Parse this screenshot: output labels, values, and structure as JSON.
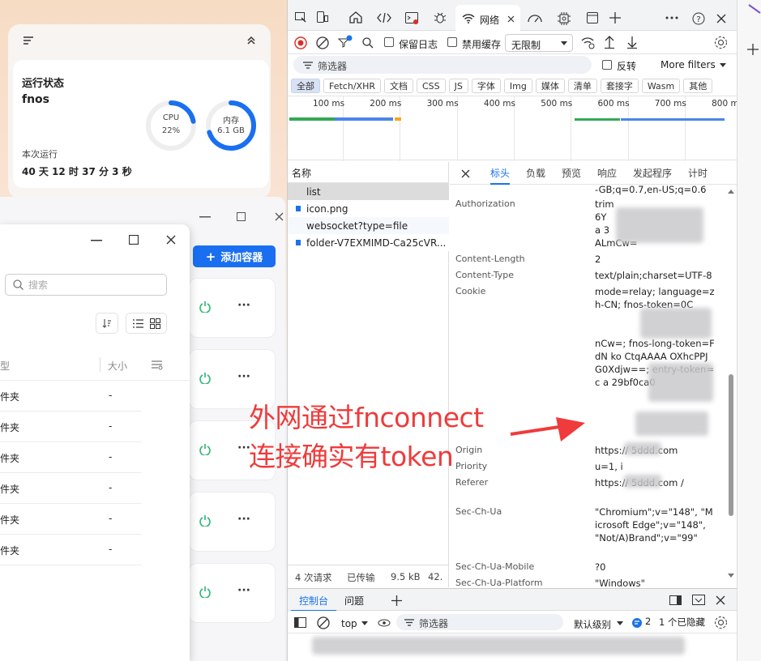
{
  "widget": {
    "title": "运行状态",
    "hostname": "fnos",
    "cpu_label": "CPU",
    "cpu_value": "22%",
    "cpu_fraction": 0.22,
    "mem_label": "内存",
    "mem_value": "6.1 GB",
    "mem_fraction": 0.7,
    "uptime_label": "本次运行",
    "uptime_value": "40 天 12 时 37 分 3 秒",
    "accent": "#1a6ff0"
  },
  "back_window": {
    "add_container_label": "添加容器",
    "container_menu_icon": "···",
    "container_count": 5
  },
  "front_window": {
    "search_placeholder": "搜索",
    "col_type": "型",
    "col_size": "大小",
    "rows": [
      {
        "type": "件夹",
        "size": "-"
      },
      {
        "type": "件夹",
        "size": "-"
      },
      {
        "type": "件夹",
        "size": "-"
      },
      {
        "type": "件夹",
        "size": "-"
      },
      {
        "type": "件夹",
        "size": "-"
      },
      {
        "type": "件夹",
        "size": "-"
      }
    ]
  },
  "devtools": {
    "network_tab": "网络",
    "preserve_log": "保留日志",
    "disable_cache": "禁用缓存",
    "throttle": "无限制",
    "filter_placeholder": "筛选器",
    "invert": "反转",
    "more_filters": "More filters",
    "type_filters": [
      "全部",
      "Fetch/XHR",
      "文档",
      "CSS",
      "JS",
      "字体",
      "Img",
      "媒体",
      "清单",
      "套接字",
      "Wasm",
      "其他"
    ],
    "timeline_ticks": [
      "100 ms",
      "200 ms",
      "300 ms",
      "400 ms",
      "500 ms",
      "600 ms",
      "700 ms",
      "800 ms"
    ],
    "name_header": "名称",
    "requests": [
      "list",
      "icon.png",
      "websocket?type=file",
      "folder-V7EXMIMD-Ca25cVR..."
    ],
    "detail_tabs": [
      "标头",
      "负载",
      "预览",
      "响应",
      "发起程序",
      "计时"
    ],
    "status": {
      "requests": "4 次请求",
      "transferred": "已传输",
      "size": "9.5 kB",
      "more": "42."
    },
    "headers": [
      {
        "key": "",
        "value": "-GB;q=0.7,en-US;q=0.6"
      },
      {
        "key": "Authorization",
        "value": "trim"
      },
      {
        "key": "",
        "value": "6Y"
      },
      {
        "key": "",
        "value": "a                3"
      },
      {
        "key": "",
        "value": "ALmCw="
      },
      {
        "key": "Content-Length",
        "value": "2"
      },
      {
        "key": "Content-Type",
        "value": "text/plain;charset=UTF-8"
      },
      {
        "key": "Cookie",
        "value": "mode=relay; language=zh-CN; fnos-token=0C"
      },
      {
        "key": "",
        "value": "nCw=; fnos-long-token=FdN          ko CtqAAAA OXhcPPJ G0Xdjw==; entry-token=c            a 29bf0ca0"
      },
      {
        "key": "Origin",
        "value": "https://          5ddd.com"
      },
      {
        "key": "Priority",
        "value": "u=1, i"
      },
      {
        "key": "Referer",
        "value": "https://          5ddd.com /"
      },
      {
        "key": "Sec-Ch-Ua",
        "value": "\"Chromium\";v=\"148\", \"Microsoft Edge\";v=\"148\", \"Not/A)Brand\";v=\"99\""
      },
      {
        "key": "Sec-Ch-Ua-Mobile",
        "value": "?0"
      },
      {
        "key": "Sec-Ch-Ua-Platform",
        "value": "\"Windows\""
      }
    ],
    "console_tab": "控制台",
    "issues_tab": "问题",
    "context": "top",
    "console_filter": "筛选器",
    "log_level": "默认级别",
    "issues_count": "2",
    "hidden_count": "1 个已隐藏"
  },
  "annotation": {
    "line1": "外网通过fnconnect",
    "line2": "连接确实有token",
    "color": "#ef3b3b"
  }
}
